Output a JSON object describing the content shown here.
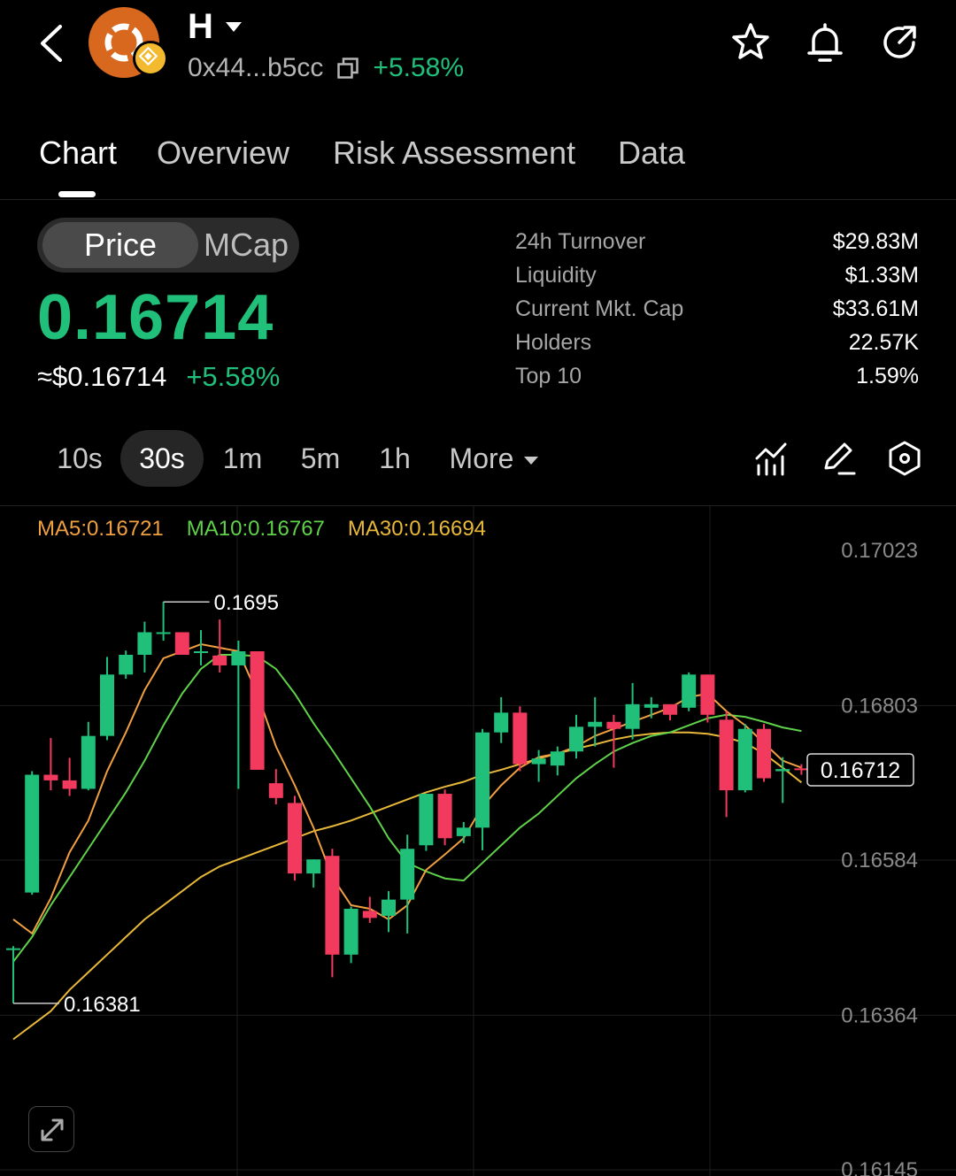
{
  "header": {
    "token_name": "H",
    "address": "0x44...b5cc",
    "change": "+5.58%",
    "icons": [
      "back-icon",
      "star-icon",
      "bell-icon",
      "share-icon",
      "copy-icon"
    ]
  },
  "tabs": [
    {
      "label": "Chart",
      "active": true
    },
    {
      "label": "Overview",
      "active": false
    },
    {
      "label": "Risk Assessment",
      "active": false
    },
    {
      "label": "Data",
      "active": false
    }
  ],
  "toggle": {
    "price": "Price",
    "mcap": "MCap"
  },
  "price": {
    "value": "0.16714",
    "usd": "≈$0.16714",
    "change": "+5.58%"
  },
  "stats": [
    {
      "label": "24h  Turnover",
      "value": "$29.83M"
    },
    {
      "label": "Liquidity",
      "value": "$1.33M"
    },
    {
      "label": "Current Mkt. Cap",
      "value": "$33.61M"
    },
    {
      "label": "Holders",
      "value": "22.57K"
    },
    {
      "label": "Top 10",
      "value": "1.59%"
    }
  ],
  "intervals": [
    {
      "label": "10s",
      "selected": false
    },
    {
      "label": "30s",
      "selected": true
    },
    {
      "label": "1m",
      "selected": false
    },
    {
      "label": "5m",
      "selected": false
    },
    {
      "label": "1h",
      "selected": false
    },
    {
      "label": "More",
      "selected": false
    }
  ],
  "colors": {
    "up": "#20c07b",
    "down": "#f23a5e",
    "ma5": "#f0a040",
    "ma10": "#5fd24a",
    "ma30": "#e8b838",
    "background": "#000000"
  },
  "chart_data": {
    "type": "candlestick",
    "interval": "30s",
    "ma_legend": [
      {
        "label": "MA5:0.16721"
      },
      {
        "label": "MA10:0.16767"
      },
      {
        "label": "MA30:0.16694"
      }
    ],
    "y_ticks": [
      "0.17023",
      "0.16803",
      "0.16584",
      "0.16364",
      "0.16145"
    ],
    "ylim": [
      0.16145,
      0.17071
    ],
    "high_marker": "0.1695",
    "low_marker": "0.16381",
    "last_price_label": "0.16712",
    "candles": [
      {
        "o": 0.16458,
        "h": 0.16462,
        "l": 0.16381,
        "c": 0.16459
      },
      {
        "o": 0.16538,
        "h": 0.1671,
        "l": 0.16535,
        "c": 0.16705
      },
      {
        "o": 0.16705,
        "h": 0.16757,
        "l": 0.16683,
        "c": 0.16697
      },
      {
        "o": 0.16697,
        "h": 0.16729,
        "l": 0.16675,
        "c": 0.16685
      },
      {
        "o": 0.16685,
        "h": 0.1678,
        "l": 0.16683,
        "c": 0.1676
      },
      {
        "o": 0.1676,
        "h": 0.16872,
        "l": 0.16754,
        "c": 0.16847
      },
      {
        "o": 0.16847,
        "h": 0.16881,
        "l": 0.16841,
        "c": 0.16875
      },
      {
        "o": 0.16875,
        "h": 0.16922,
        "l": 0.1685,
        "c": 0.16907
      },
      {
        "o": 0.16907,
        "h": 0.1695,
        "l": 0.16895,
        "c": 0.16907
      },
      {
        "o": 0.16907,
        "h": 0.16903,
        "l": 0.16875,
        "c": 0.16875
      },
      {
        "o": 0.1688,
        "h": 0.1691,
        "l": 0.1686,
        "c": 0.1688
      },
      {
        "o": 0.16874,
        "h": 0.16925,
        "l": 0.1685,
        "c": 0.1686
      },
      {
        "o": 0.1686,
        "h": 0.16895,
        "l": 0.16685,
        "c": 0.1688
      },
      {
        "o": 0.1688,
        "h": 0.16875,
        "l": 0.16712,
        "c": 0.16712
      },
      {
        "o": 0.16693,
        "h": 0.16713,
        "l": 0.16663,
        "c": 0.16672
      },
      {
        "o": 0.16665,
        "h": 0.16675,
        "l": 0.16555,
        "c": 0.16565
      },
      {
        "o": 0.16565,
        "h": 0.16585,
        "l": 0.16545,
        "c": 0.16585
      },
      {
        "o": 0.1659,
        "h": 0.166,
        "l": 0.16418,
        "c": 0.1645
      },
      {
        "o": 0.1645,
        "h": 0.16518,
        "l": 0.16438,
        "c": 0.16515
      },
      {
        "o": 0.16512,
        "h": 0.16532,
        "l": 0.16495,
        "c": 0.16502
      },
      {
        "o": 0.16505,
        "h": 0.1654,
        "l": 0.16482,
        "c": 0.16528
      },
      {
        "o": 0.16528,
        "h": 0.1662,
        "l": 0.1648,
        "c": 0.166
      },
      {
        "o": 0.16605,
        "h": 0.16678,
        "l": 0.16597,
        "c": 0.16678
      },
      {
        "o": 0.16678,
        "h": 0.16684,
        "l": 0.16605,
        "c": 0.16615
      },
      {
        "o": 0.16618,
        "h": 0.16638,
        "l": 0.16608,
        "c": 0.1663
      },
      {
        "o": 0.1663,
        "h": 0.1677,
        "l": 0.16598,
        "c": 0.16765
      },
      {
        "o": 0.16765,
        "h": 0.16815,
        "l": 0.1675,
        "c": 0.16793
      },
      {
        "o": 0.16793,
        "h": 0.16802,
        "l": 0.1671,
        "c": 0.1672
      },
      {
        "o": 0.1672,
        "h": 0.1674,
        "l": 0.16695,
        "c": 0.16728
      },
      {
        "o": 0.16718,
        "h": 0.16745,
        "l": 0.16704,
        "c": 0.16738
      },
      {
        "o": 0.16738,
        "h": 0.1679,
        "l": 0.16728,
        "c": 0.16773
      },
      {
        "o": 0.16773,
        "h": 0.16815,
        "l": 0.16745,
        "c": 0.1678
      },
      {
        "o": 0.1678,
        "h": 0.1679,
        "l": 0.16715,
        "c": 0.1677
      },
      {
        "o": 0.1677,
        "h": 0.16835,
        "l": 0.16755,
        "c": 0.16805
      },
      {
        "o": 0.168,
        "h": 0.16815,
        "l": 0.16785,
        "c": 0.16805
      },
      {
        "o": 0.16805,
        "h": 0.16803,
        "l": 0.16782,
        "c": 0.1679
      },
      {
        "o": 0.168,
        "h": 0.1685,
        "l": 0.16795,
        "c": 0.16847
      },
      {
        "o": 0.16847,
        "h": 0.16847,
        "l": 0.16779,
        "c": 0.1679
      },
      {
        "o": 0.16783,
        "h": 0.16795,
        "l": 0.16645,
        "c": 0.16683
      },
      {
        "o": 0.16683,
        "h": 0.16777,
        "l": 0.1668,
        "c": 0.1677
      },
      {
        "o": 0.1677,
        "h": 0.16777,
        "l": 0.16695,
        "c": 0.167
      },
      {
        "o": 0.1671,
        "h": 0.1673,
        "l": 0.16665,
        "c": 0.16713
      },
      {
        "o": 0.16714,
        "h": 0.1672,
        "l": 0.16705,
        "c": 0.16712
      }
    ],
    "ma5": [
      0.165,
      0.1648,
      0.1653,
      0.16595,
      0.1664,
      0.1671,
      0.16765,
      0.16825,
      0.1687,
      0.1688,
      0.1689,
      0.16885,
      0.1688,
      0.1682,
      0.16745,
      0.1669,
      0.1663,
      0.1656,
      0.1652,
      0.16515,
      0.165,
      0.1652,
      0.1657,
      0.16592,
      0.16615,
      0.1666,
      0.1669,
      0.16715,
      0.1673,
      0.16735,
      0.16745,
      0.1676,
      0.1677,
      0.1678,
      0.1679,
      0.168,
      0.16815,
      0.1682,
      0.16795,
      0.16775,
      0.1675,
      0.16725,
      0.16715
    ],
    "ma10": [
      0.1644,
      0.16475,
      0.1652,
      0.1656,
      0.166,
      0.1664,
      0.1668,
      0.16725,
      0.16775,
      0.1682,
      0.16855,
      0.16875,
      0.16875,
      0.16873,
      0.16855,
      0.1682,
      0.16778,
      0.1674,
      0.167,
      0.1666,
      0.16615,
      0.1658,
      0.16568,
      0.16558,
      0.16555,
      0.1658,
      0.16605,
      0.1663,
      0.1665,
      0.16675,
      0.167,
      0.1672,
      0.16738,
      0.1675,
      0.1676,
      0.16765,
      0.16775,
      0.16785,
      0.1679,
      0.16787,
      0.1678,
      0.16772,
      0.16767
    ],
    "ma30": [
      0.1633,
      0.1635,
      0.1637,
      0.164,
      0.16425,
      0.1645,
      0.16475,
      0.165,
      0.1652,
      0.1654,
      0.1656,
      0.16575,
      0.16585,
      0.16595,
      0.16605,
      0.16615,
      0.16625,
      0.16632,
      0.1664,
      0.1665,
      0.1666,
      0.1667,
      0.1668,
      0.16688,
      0.16695,
      0.16705,
      0.16712,
      0.1672,
      0.16728,
      0.16735,
      0.16742,
      0.16748,
      0.16755,
      0.1676,
      0.16763,
      0.16765,
      0.16765,
      0.16763,
      0.16758,
      0.1675,
      0.16735,
      0.16715,
      0.16694
    ]
  }
}
